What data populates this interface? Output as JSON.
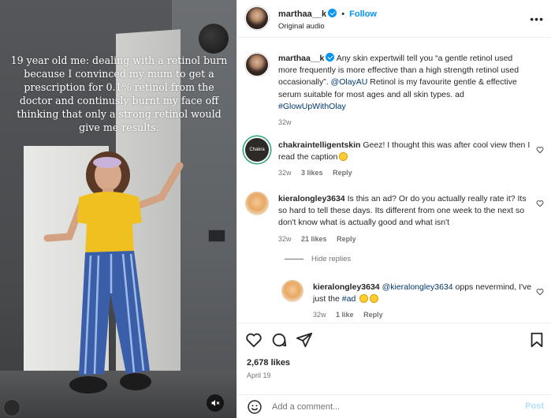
{
  "media": {
    "overlay_text": "19 year old me: dealing with a retinol burn because I convinced my mum to get a prescription for 0.1% retinol from the doctor and continusly burnt my face off thinking that only a strong retinol would give me results.",
    "mute_icon": "speaker-muted-icon"
  },
  "header": {
    "username": "marthaa__k",
    "dot": "•",
    "follow_label": "Follow",
    "audio_label": "Original audio",
    "more_label": "•••"
  },
  "caption": {
    "username": "marthaa__k",
    "text_before": "Any skin expertwill tell you “a gentle retinol used more frequently is more effective than a high strength retinol used occasionally”. ",
    "mention": "@OlayAU",
    "text_after": " Retinol is my favourite gentle & effective serum suitable for most ages and all skin types. ad ",
    "hashtag": "#GlowUpWithOlay",
    "time": "32w"
  },
  "comments": [
    {
      "username": "chakraintelligentskin",
      "avatar_text": "Chakra",
      "text": "Geez! I thought this was after cool view then I read the caption",
      "time": "32w",
      "likes": "3 likes",
      "reply_label": "Reply"
    },
    {
      "username": "kieralongley3634",
      "text": "Is this an ad? Or do you actually really rate it? Its so hard to tell these days. Its different from one week to the next so don't know what is actually good and what isn't",
      "time": "32w",
      "likes": "21 likes",
      "reply_label": "Reply"
    }
  ],
  "hide_replies_label": "Hide replies",
  "reply": {
    "username": "kieralongley3634",
    "mention": "@kieralongley3634",
    "text": " opps nevermind, I've just the ",
    "hashtag": "#ad",
    "time": "32w",
    "likes": "1 like",
    "reply_label": "Reply"
  },
  "actions": {
    "likes": "2,678 likes",
    "date": "April 19"
  },
  "add_comment": {
    "placeholder": "Add a comment...",
    "post_label": "Post"
  }
}
